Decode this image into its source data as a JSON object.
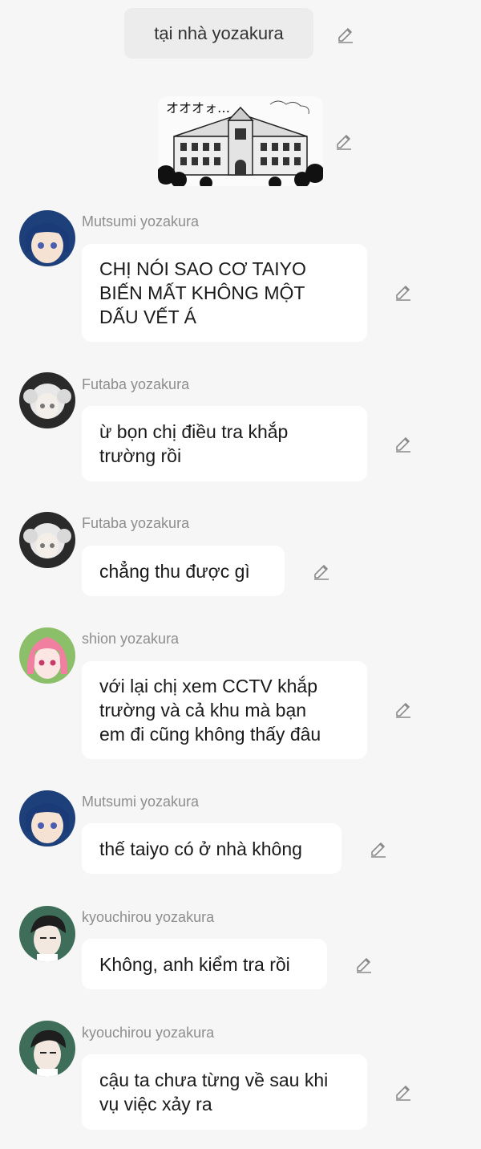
{
  "scene_label": "tại nhà yozakura",
  "messages": [
    {
      "sender": "Mutsumi yozakura",
      "text": "CHỊ NÓI SAO CƠ TAIYO\nBIẾN MẤT KHÔNG MỘT\nDẤU VẾT Á",
      "avatar": "mutsumi-avatar"
    },
    {
      "sender": "Futaba yozakura",
      "text": "ừ bọn chị điều tra khắp\ntrường rồi",
      "avatar": "futaba-avatar"
    },
    {
      "sender": "Futaba yozakura",
      "text": "chẳng thu được gì",
      "avatar": "futaba-avatar"
    },
    {
      "sender": "shion yozakura",
      "text": "với lại chị xem CCTV khắp\ntrường và cả khu mà bạn\nem đi cũng không thấy đâu",
      "avatar": "shion-avatar"
    },
    {
      "sender": "Mutsumi yozakura",
      "text": "thế taiyo có ở nhà không",
      "avatar": "mutsumi-avatar"
    },
    {
      "sender": "kyouchirou yozakura",
      "text": "Không, anh kiểm tra rồi",
      "avatar": "kyouchirou-avatar"
    },
    {
      "sender": "kyouchirou yozakura",
      "text": "cậu ta chưa từng về sau khi\nvụ việc xảy ra",
      "avatar": "kyouchirou-avatar"
    }
  ],
  "image_caption": "オオオォ…",
  "icons": {
    "edit": "pencil-edit-icon"
  },
  "colors": {
    "background": "#f6f6f6",
    "bubble": "#ffffff",
    "sender_name": "#8e8e8e"
  }
}
